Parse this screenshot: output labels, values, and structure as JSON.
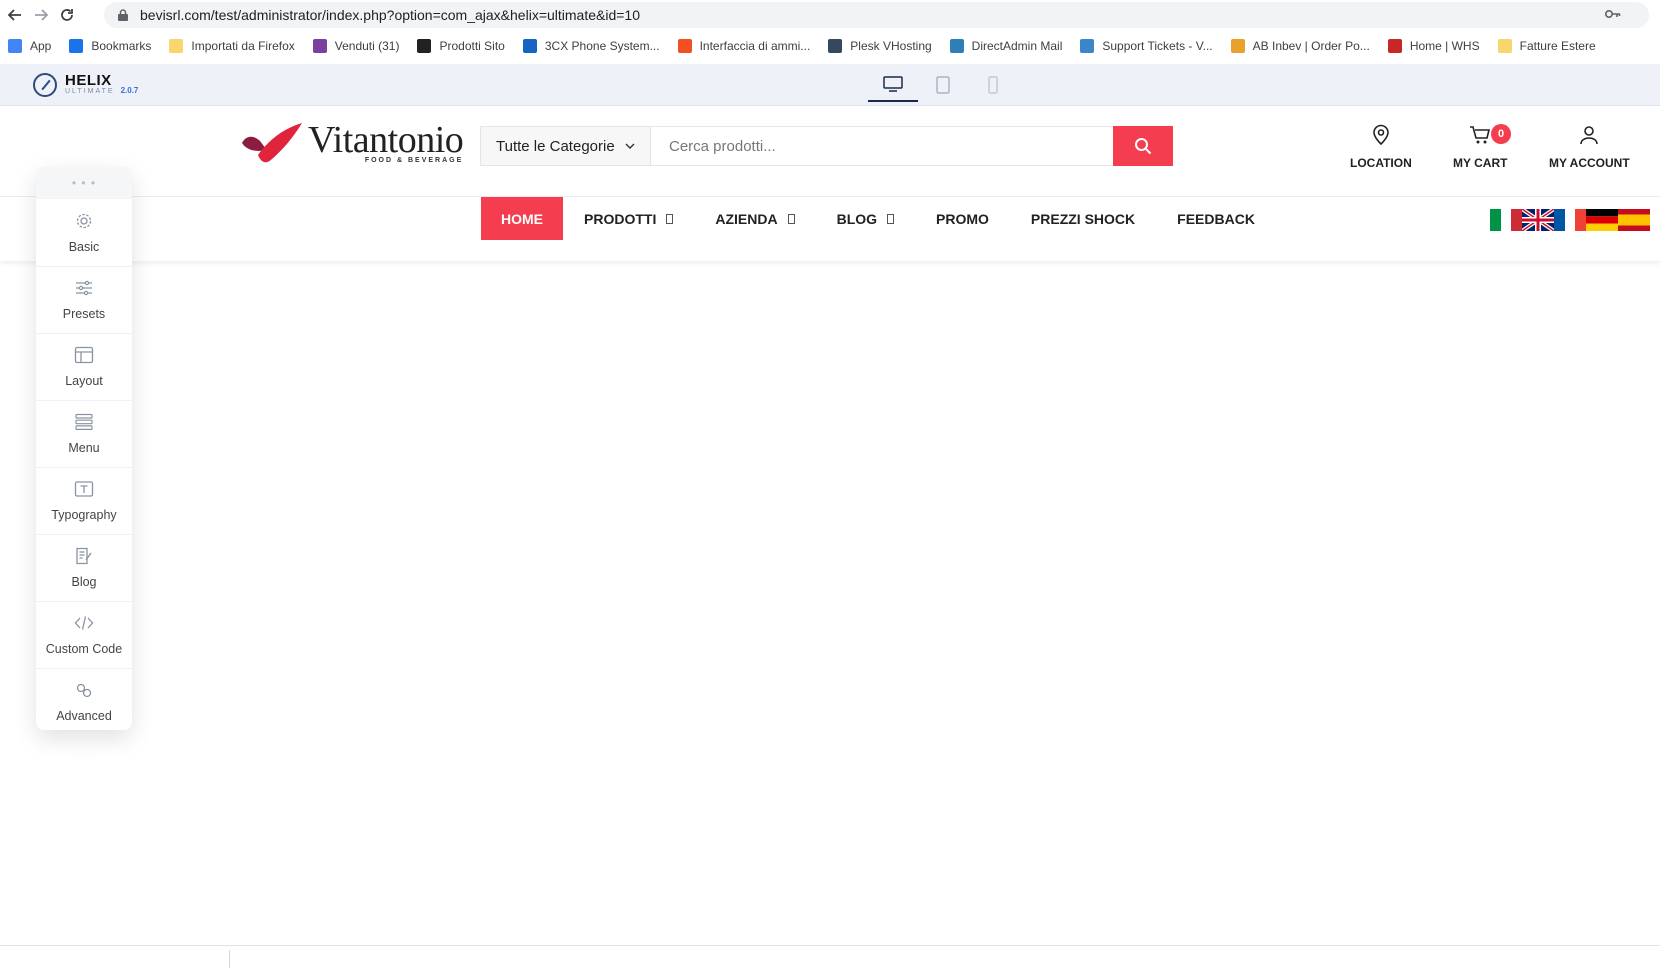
{
  "browser": {
    "url": "bevisrl.com/test/administrator/index.php?option=com_ajax&helix=ultimate&id=10",
    "bookmarks": [
      {
        "label": "App",
        "icon": "apps-grid-icon",
        "color": "#4285f4"
      },
      {
        "label": "Bookmarks",
        "icon": "star-icon",
        "color": "#1a73e8"
      },
      {
        "label": "Importati da Firefox",
        "icon": "folder-icon",
        "color": "#f9d56e"
      },
      {
        "label": "Venduti (31)",
        "icon": "bag-icon",
        "color": "#7b3fa0"
      },
      {
        "label": "Prodotti Sito",
        "icon": "joomla-icon",
        "color": "#222222"
      },
      {
        "label": "3CX Phone System...",
        "icon": "3cx-icon",
        "color": "#1565c0"
      },
      {
        "label": "Interfaccia di ammi...",
        "icon": "microsoft-icon",
        "color": "#f25022"
      },
      {
        "label": "Plesk VHosting",
        "icon": "plesk-icon",
        "color": "#34495e"
      },
      {
        "label": "DirectAdmin Mail",
        "icon": "directadmin-icon",
        "color": "#2e7fb8"
      },
      {
        "label": "Support Tickets - V...",
        "icon": "ticket-icon",
        "color": "#3a86c8"
      },
      {
        "label": "AB Inbev | Order Po...",
        "icon": "abinbev-icon",
        "color": "#e8a12a"
      },
      {
        "label": "Home | WHS",
        "icon": "whs-icon",
        "color": "#c62828"
      },
      {
        "label": "Fatture Estere",
        "icon": "folder-icon",
        "color": "#f9d56e"
      }
    ]
  },
  "helix": {
    "brand": "HELIX",
    "sub": "ULTIMATE",
    "version": "2.0.7"
  },
  "header": {
    "logo_name": "Vitantonio",
    "logo_tag": "FOOD & BEVERAGE",
    "category_select": "Tutte le Categorie",
    "search_placeholder": "Cerca prodotti...",
    "location_label": "LOCATION",
    "cart_label": "MY CART",
    "cart_count": "0",
    "account_label": "MY ACCOUNT"
  },
  "nav": {
    "items": [
      {
        "label": "HOME",
        "active": true,
        "dropdown": false
      },
      {
        "label": "PRODOTTI",
        "active": false,
        "dropdown": true
      },
      {
        "label": "AZIENDA",
        "active": false,
        "dropdown": true
      },
      {
        "label": "BLOG",
        "active": false,
        "dropdown": true
      },
      {
        "label": "PROMO",
        "active": false,
        "dropdown": false
      },
      {
        "label": "PREZZI SHOCK",
        "active": false,
        "dropdown": false
      },
      {
        "label": "FEEDBACK",
        "active": false,
        "dropdown": false
      }
    ]
  },
  "sidebar": {
    "items": [
      {
        "label": "Basic",
        "icon": "gear-icon"
      },
      {
        "label": "Presets",
        "icon": "sliders-icon"
      },
      {
        "label": "Layout",
        "icon": "layout-icon"
      },
      {
        "label": "Menu",
        "icon": "menu-list-icon"
      },
      {
        "label": "Typography",
        "icon": "typography-icon"
      },
      {
        "label": "Blog",
        "icon": "blog-icon"
      },
      {
        "label": "Custom Code",
        "icon": "code-icon"
      },
      {
        "label": "Advanced",
        "icon": "advanced-icon"
      }
    ]
  },
  "colors": {
    "accent": "#f43e4f",
    "helix_bar": "#eef2f8"
  }
}
